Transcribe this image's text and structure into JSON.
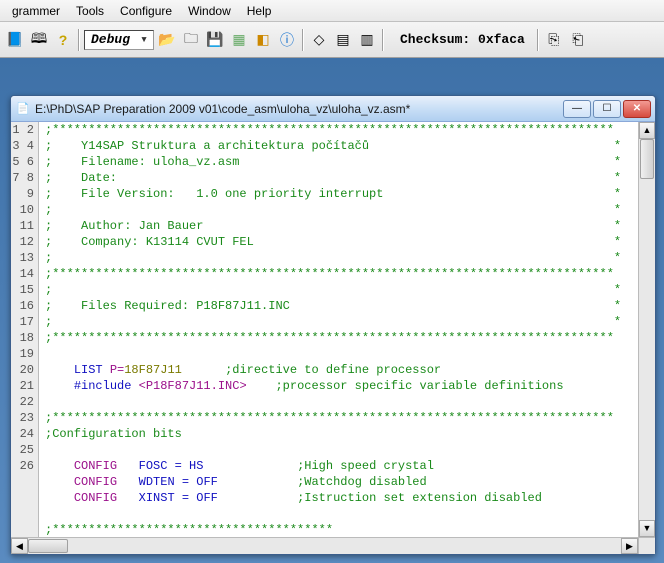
{
  "menu": {
    "items": [
      "grammer",
      "Tools",
      "Configure",
      "Window",
      "Help"
    ]
  },
  "toolbar": {
    "combo": "Debug",
    "checksum_label": "Checksum:",
    "checksum_value": "0xfaca"
  },
  "editor": {
    "title": "E:\\PhD\\SAP Preparation 2009 v01\\code_asm\\uloha_vz\\uloha_vz.asm*",
    "gutter_start": 1,
    "gutter_end": 26,
    "lines": [
      {
        "type": "stars"
      },
      {
        "type": "cmt",
        "prefix": ";    ",
        "text": "Y14SAP Struktura a architektura počítačů",
        "suffix": "*"
      },
      {
        "type": "cmt",
        "prefix": ";    ",
        "text": "Filename: uloha_vz.asm",
        "suffix": "*"
      },
      {
        "type": "cmt",
        "prefix": ";    ",
        "text": "Date:",
        "suffix": "*"
      },
      {
        "type": "cmt",
        "prefix": ";    ",
        "text": "File Version:   1.0 one priority interrupt",
        "suffix": "*"
      },
      {
        "type": "cmt",
        "prefix": ";",
        "text": "",
        "suffix": "*"
      },
      {
        "type": "cmt",
        "prefix": ";    ",
        "text": "Author: Jan Bauer",
        "suffix": "*"
      },
      {
        "type": "cmt",
        "prefix": ";    ",
        "text": "Company: K13114 CVUT FEL",
        "suffix": "*"
      },
      {
        "type": "cmt",
        "prefix": ";",
        "text": "",
        "suffix": "*"
      },
      {
        "type": "stars"
      },
      {
        "type": "cmt",
        "prefix": ";",
        "text": "",
        "suffix": "*"
      },
      {
        "type": "cmt",
        "prefix": ";    ",
        "text": "Files Required: P18F87J11.INC",
        "suffix": "*"
      },
      {
        "type": "cmt",
        "prefix": ";",
        "text": "",
        "suffix": "*"
      },
      {
        "type": "stars"
      },
      {
        "type": "blank"
      },
      {
        "type": "list",
        "kw": "LIST",
        "arg": "P=",
        "val": "18F87J11",
        "cmt": ";directive to define processor"
      },
      {
        "type": "include",
        "kw": "#include",
        "file": "<P18F87J11.INC>",
        "cmt": ";processor specific variable definitions"
      },
      {
        "type": "blank"
      },
      {
        "type": "stars"
      },
      {
        "type": "cmt",
        "prefix": "",
        "text": ";Configuration bits",
        "suffix": ""
      },
      {
        "type": "blank"
      },
      {
        "type": "config",
        "kw": "CONFIG",
        "flag": "FOSC = HS",
        "cmt": ";High speed crystal"
      },
      {
        "type": "config",
        "kw": "CONFIG",
        "flag": "WDTEN = OFF",
        "cmt": ";Watchdog disabled"
      },
      {
        "type": "config",
        "kw": "CONFIG",
        "flag": "XINST = OFF",
        "cmt": ";Istruction set extension disabled"
      },
      {
        "type": "blank"
      },
      {
        "type": "stars_partial"
      }
    ],
    "star_line": ";******************************************************************************"
  }
}
